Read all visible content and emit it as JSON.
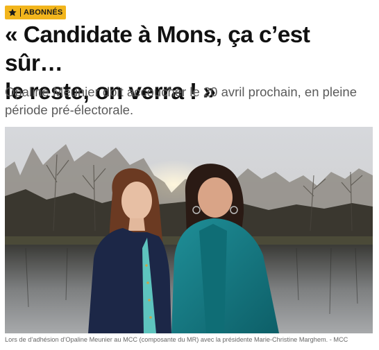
{
  "badge": {
    "icon": "star-icon",
    "label": "ABONNÉS",
    "color": "#f2b51c"
  },
  "headline": {
    "line1": "« Candidate à Mons, ça c’est sûr…",
    "line2": "le reste, on verra ! »"
  },
  "lead": "Opaline Meunier doit accoucher le 20 avril prochain, en pleine période pré-électorale.",
  "photo": {
    "caption": "Lors de d’adhésion d’Opaline Meunier au MCC (composante du MR) avec la présidente Marie-Christine Marghem. - MCC"
  }
}
